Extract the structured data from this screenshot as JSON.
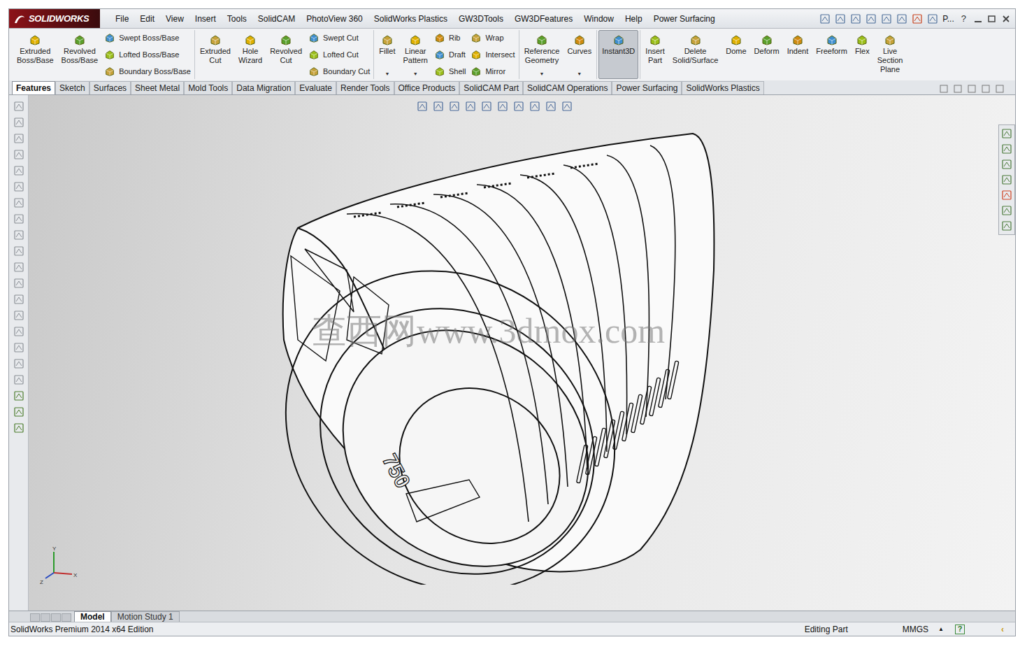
{
  "window": {
    "logo": "SOLIDWORKS",
    "overflow": "P...",
    "help": "?"
  },
  "menus": [
    "File",
    "Edit",
    "View",
    "Insert",
    "Tools",
    "SolidCAM",
    "PhotoView 360",
    "SolidWorks Plastics",
    "GW3DTools",
    "GW3DFeatures",
    "Window",
    "Help",
    "Power Surfacing"
  ],
  "command_groups": [
    [
      {
        "kind": "large",
        "label": "Extruded Boss/Base",
        "selected": false,
        "dropdown": false
      },
      {
        "kind": "large",
        "label": "Revolved Boss/Base",
        "selected": false,
        "dropdown": false
      },
      {
        "kind": "stack",
        "items": [
          "Swept Boss/Base",
          "Lofted Boss/Base",
          "Boundary Boss/Base"
        ]
      }
    ],
    [
      {
        "kind": "large",
        "label": "Extruded Cut",
        "selected": false,
        "dropdown": false
      },
      {
        "kind": "large",
        "label": "Hole Wizard",
        "selected": false,
        "dropdown": false
      },
      {
        "kind": "large",
        "label": "Revolved Cut",
        "selected": false,
        "dropdown": false
      },
      {
        "kind": "stack",
        "items": [
          "Swept Cut",
          "Lofted Cut",
          "Boundary Cut"
        ]
      }
    ],
    [
      {
        "kind": "large",
        "label": "Fillet",
        "selected": false,
        "dropdown": true
      },
      {
        "kind": "large",
        "label": "Linear Pattern",
        "selected": false,
        "dropdown": true
      },
      {
        "kind": "stack",
        "items": [
          "Rib",
          "Draft",
          "Shell"
        ]
      },
      {
        "kind": "stack",
        "items": [
          "Wrap",
          "Intersect",
          "Mirror"
        ]
      }
    ],
    [
      {
        "kind": "large",
        "label": "Reference Geometry",
        "selected": false,
        "dropdown": true
      },
      {
        "kind": "large",
        "label": "Curves",
        "selected": false,
        "dropdown": true
      }
    ],
    [
      {
        "kind": "large",
        "label": "Instant3D",
        "selected": true,
        "dropdown": false
      }
    ],
    [
      {
        "kind": "large",
        "label": "Insert Part",
        "selected": false,
        "dropdown": false
      },
      {
        "kind": "large",
        "label": "Delete Solid/Surface",
        "selected": false,
        "dropdown": false
      },
      {
        "kind": "large",
        "label": "Dome",
        "selected": false,
        "dropdown": false
      },
      {
        "kind": "large",
        "label": "Deform",
        "selected": false,
        "dropdown": false
      },
      {
        "kind": "large",
        "label": "Indent",
        "selected": false,
        "dropdown": false
      },
      {
        "kind": "large",
        "label": "Freeform",
        "selected": false,
        "dropdown": false
      },
      {
        "kind": "large",
        "label": "Flex",
        "selected": false,
        "dropdown": false
      },
      {
        "kind": "large",
        "label": "Live Section Plane",
        "selected": false,
        "dropdown": false
      }
    ]
  ],
  "tabs": [
    {
      "label": "Features",
      "selected": true
    },
    {
      "label": "Sketch",
      "selected": false
    },
    {
      "label": "Surfaces",
      "selected": false
    },
    {
      "label": "Sheet Metal",
      "selected": false
    },
    {
      "label": "Mold Tools",
      "selected": false
    },
    {
      "label": "Data Migration",
      "selected": false
    },
    {
      "label": "Evaluate",
      "selected": false
    },
    {
      "label": "Render Tools",
      "selected": false
    },
    {
      "label": "Office Products",
      "selected": false
    },
    {
      "label": "SolidCAM Part",
      "selected": false
    },
    {
      "label": "SolidCAM Operations",
      "selected": false
    },
    {
      "label": "Power Surfacing",
      "selected": false
    },
    {
      "label": "SolidWorks Plastics",
      "selected": false
    }
  ],
  "viewport": {
    "watermark": "查西网www.3dmox.com",
    "engraving": "750",
    "triad": [
      "Y",
      "X",
      "Z"
    ]
  },
  "bottom_tabs": [
    {
      "label": "Model",
      "selected": true
    },
    {
      "label": "Motion Study 1",
      "selected": false
    }
  ],
  "status_bar": {
    "edition": "SolidWorks Premium 2014 x64 Edition",
    "mode": "Editing Part",
    "units": "MMGS",
    "units_arrow": "▲",
    "help": "?",
    "collapse": "‹"
  }
}
